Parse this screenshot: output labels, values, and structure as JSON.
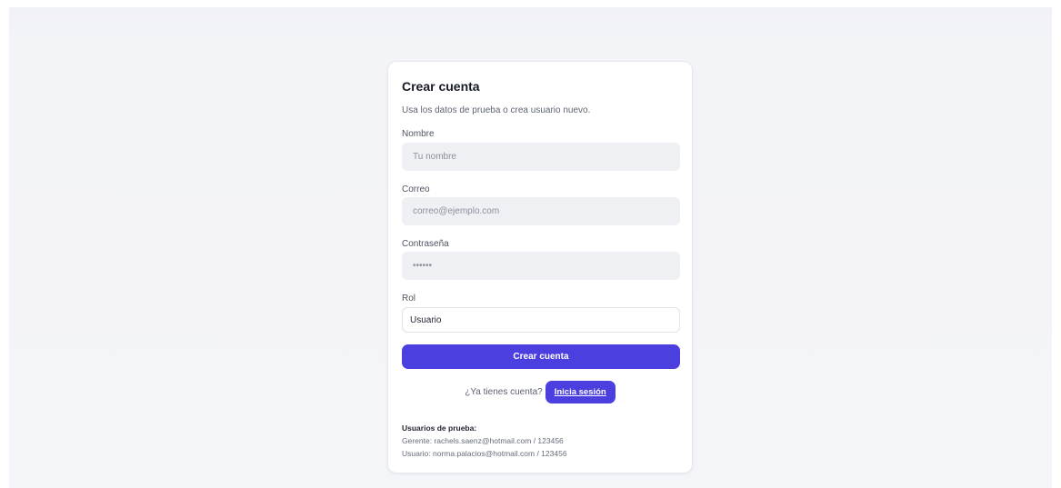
{
  "form": {
    "title": "Crear cuenta",
    "subtitle": "Usa los datos de prueba o crea usuario nuevo.",
    "name": {
      "label": "Nombre",
      "placeholder": "Tu nombre"
    },
    "email": {
      "label": "Correo",
      "placeholder": "correo@ejemplo.com"
    },
    "password": {
      "label": "Contraseña",
      "placeholder": "••••••"
    },
    "role": {
      "label": "Rol",
      "selected": "Usuario"
    },
    "submit_label": "Crear cuenta"
  },
  "login": {
    "question": "¿Ya tienes cuenta?",
    "link_label": "Inicia sesión"
  },
  "test_users": {
    "title": "Usuarios de prueba:",
    "manager": "Gerente: rachels.saenz@hotmail.com / 123456",
    "user": "Usuario: norma.palacios@hotmail.com / 123456"
  },
  "colors": {
    "accent": "#4b3fe0",
    "input_bg": "#eff0f3",
    "page_bg": "#f4f5f8"
  }
}
